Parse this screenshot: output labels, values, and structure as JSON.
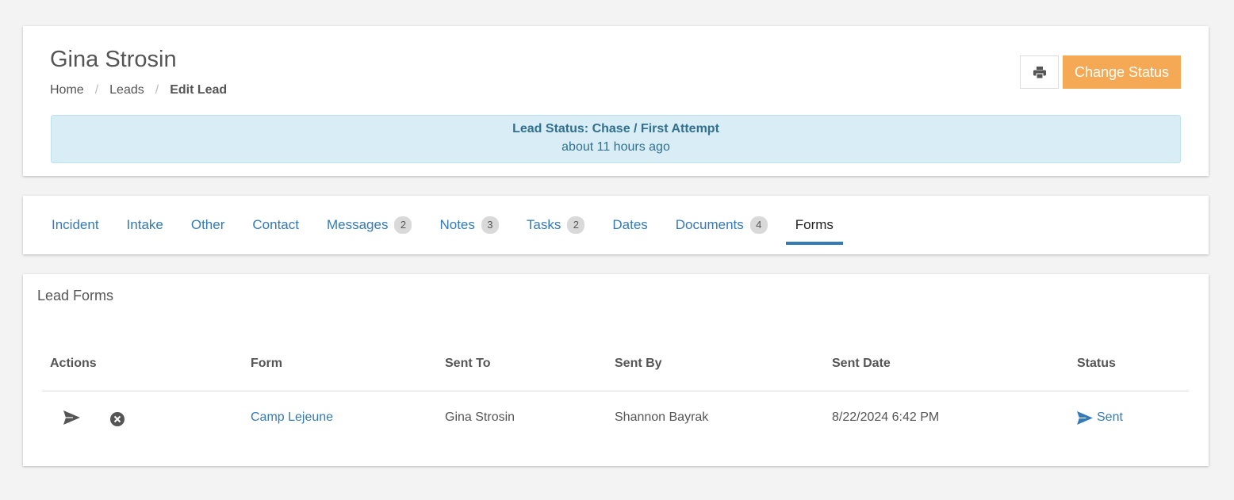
{
  "header": {
    "title": "Gina Strosin",
    "breadcrumb": [
      "Home",
      "Leads",
      "Edit Lead"
    ],
    "print_icon": "print-icon",
    "change_status_label": "Change Status",
    "status_line": "Lead Status: Chase / First Attempt",
    "status_time": "about 11 hours ago"
  },
  "tabs": [
    {
      "label": "Incident",
      "badge": ""
    },
    {
      "label": "Intake",
      "badge": ""
    },
    {
      "label": "Other",
      "badge": ""
    },
    {
      "label": "Contact",
      "badge": ""
    },
    {
      "label": "Messages",
      "badge": "2"
    },
    {
      "label": "Notes",
      "badge": "3"
    },
    {
      "label": "Tasks",
      "badge": "2"
    },
    {
      "label": "Dates",
      "badge": ""
    },
    {
      "label": "Documents",
      "badge": "4"
    },
    {
      "label": "Forms",
      "badge": "",
      "active": true
    }
  ],
  "forms": {
    "title": "Lead Forms",
    "columns": [
      "Actions",
      "Form",
      "Sent To",
      "Sent By",
      "Sent Date",
      "Status"
    ],
    "rows": [
      {
        "form": "Camp Lejeune",
        "sent_to": "Gina Strosin",
        "sent_by": "Shannon Bayrak",
        "sent_date": "8/22/2024 6:42 PM",
        "status": "Sent"
      }
    ]
  },
  "colors": {
    "accent": "#337ab7",
    "change_status_bg": "#f6a955",
    "alert_bg": "#d8edf6",
    "alert_text": "#31708f"
  }
}
